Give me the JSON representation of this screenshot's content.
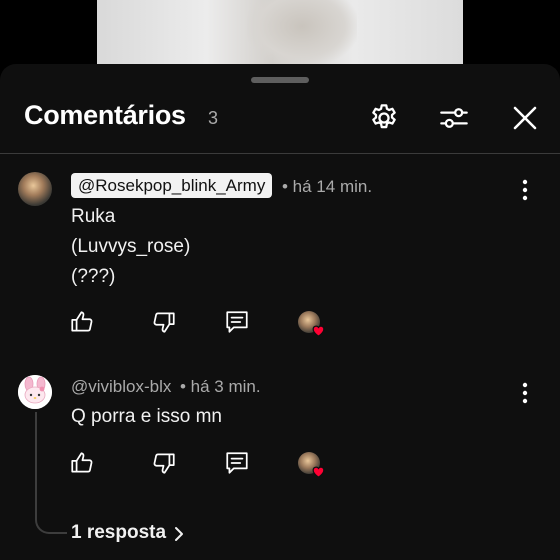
{
  "header": {
    "title": "Comentários",
    "count": "3",
    "settings_icon": "gear-icon",
    "filter_icon": "sliders-icon",
    "close_icon": "close-icon"
  },
  "comments": [
    {
      "author": "@Rosekpop_blink_Army",
      "time": "• há 14 min.",
      "lines": [
        "Ruka",
        "(Luvvys_rose)",
        "(???)"
      ],
      "author_highlighted": true
    },
    {
      "author": "@viviblox-blx",
      "time": "• há 3 min.",
      "lines": [
        "Q porra e isso mn"
      ],
      "author_highlighted": false
    }
  ],
  "replies": {
    "label": "1 resposta"
  },
  "colors": {
    "sheet_bg": "#0f0f0f",
    "heart": "#ff0033",
    "meta_text": "#aaaaaa"
  }
}
